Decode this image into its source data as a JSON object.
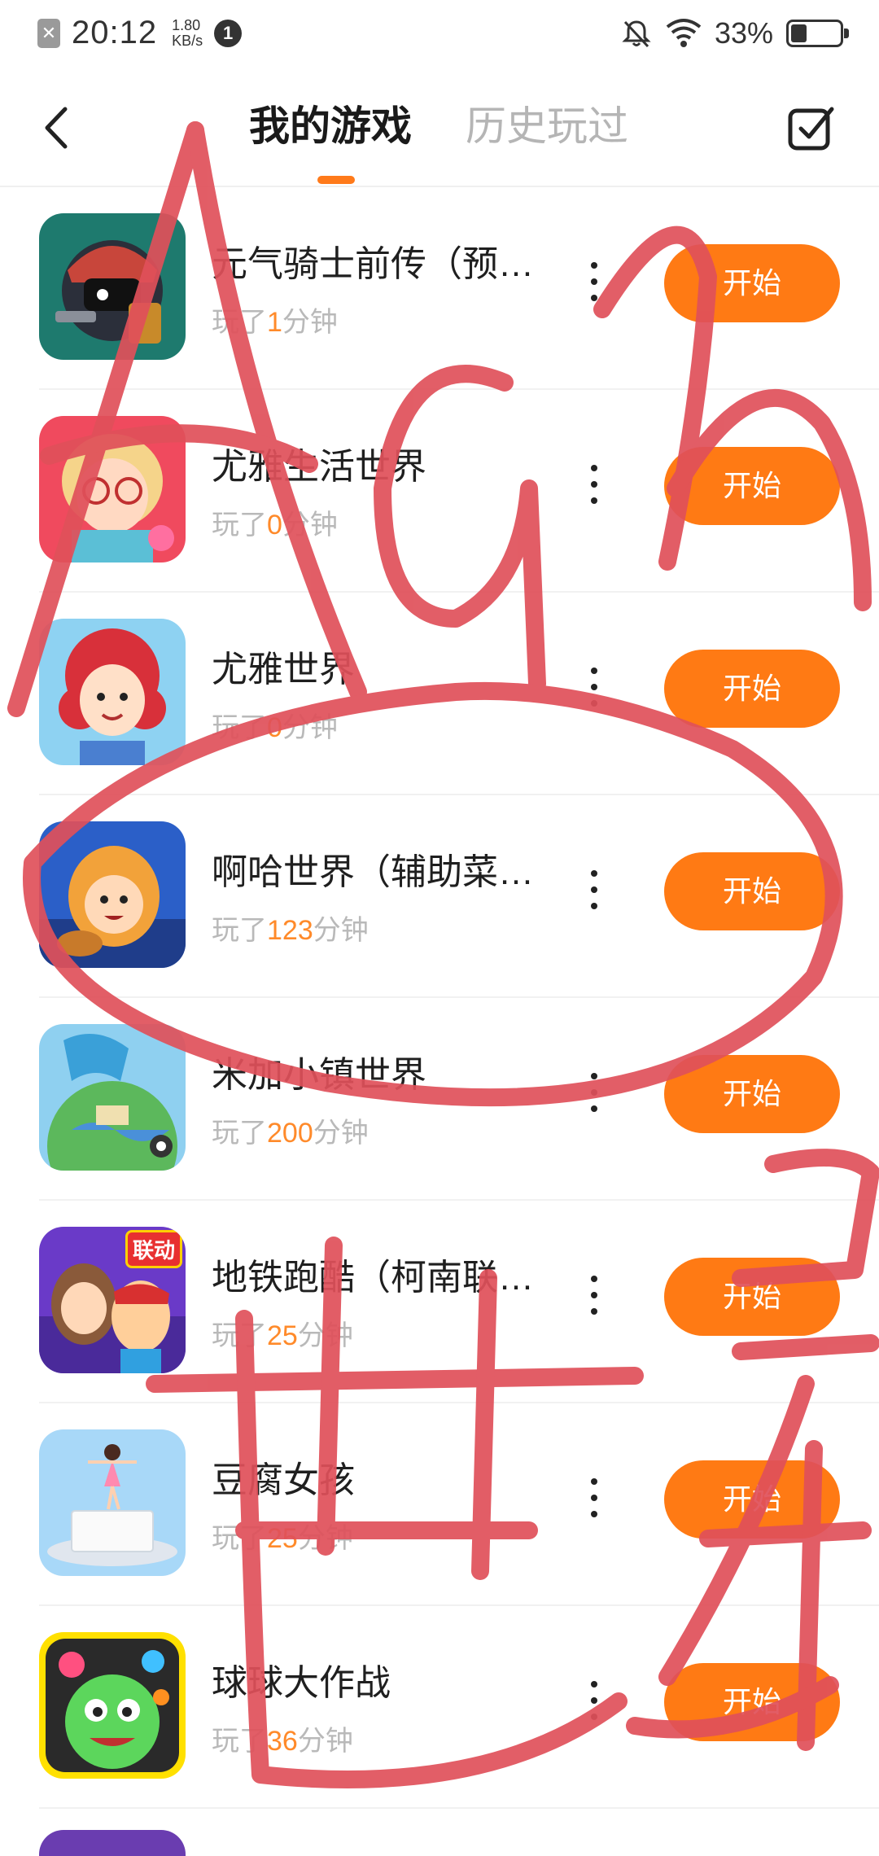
{
  "status_bar": {
    "time": "20:12",
    "speed_value": "1.80",
    "speed_unit": "KB/s",
    "notification_count": "1",
    "battery_percent": "33%",
    "battery_level": 0.33
  },
  "header": {
    "tabs": [
      {
        "label": "我的游戏",
        "active": true
      },
      {
        "label": "历史玩过",
        "active": false
      }
    ]
  },
  "games": [
    {
      "title": "元气骑士前传（预…",
      "played_prefix": "玩了",
      "minutes": "1",
      "played_suffix": "分钟",
      "button": "开始",
      "icon": "knight-game-icon"
    },
    {
      "title": "尤雅生活世界",
      "played_prefix": "玩了",
      "minutes": "0",
      "played_suffix": "分钟",
      "button": "开始",
      "icon": "girl-glasses-game-icon"
    },
    {
      "title": "尤雅世界",
      "played_prefix": "玩了",
      "minutes": "0",
      "played_suffix": "分钟",
      "button": "开始",
      "icon": "redhair-girl-game-icon"
    },
    {
      "title": "啊哈世界（辅助菜…",
      "played_prefix": "玩了",
      "minutes": "123",
      "played_suffix": "分钟",
      "button": "开始",
      "icon": "tiger-costume-game-icon"
    },
    {
      "title": "米加小镇世界",
      "played_prefix": "玩了",
      "minutes": "200",
      "played_suffix": "分钟",
      "button": "开始",
      "icon": "globe-town-game-icon"
    },
    {
      "title": "地铁跑酷（柯南联…",
      "played_prefix": "玩了",
      "minutes": "25",
      "played_suffix": "分钟",
      "button": "开始",
      "icon": "subway-runner-game-icon"
    },
    {
      "title": "豆腐女孩",
      "played_prefix": "玩了",
      "minutes": "25",
      "played_suffix": "分钟",
      "button": "开始",
      "icon": "tofu-girl-game-icon"
    },
    {
      "title": "球球大作战",
      "played_prefix": "玩了",
      "minutes": "36",
      "played_suffix": "分钟",
      "button": "开始",
      "icon": "ball-battle-game-icon"
    }
  ],
  "icon_badge_text": "联动",
  "colors": {
    "accent": "#ff7a14",
    "minutes": "#ff8a2a",
    "scribble": "#e0505a"
  }
}
